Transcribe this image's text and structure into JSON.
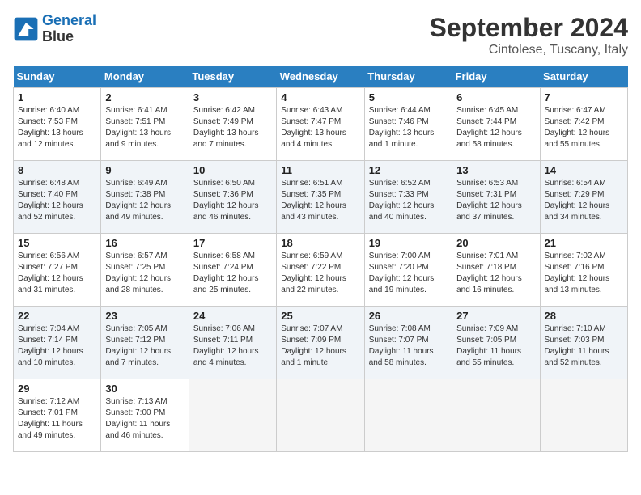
{
  "header": {
    "logo_line1": "General",
    "logo_line2": "Blue",
    "month_title": "September 2024",
    "subtitle": "Cintolese, Tuscany, Italy"
  },
  "days_of_week": [
    "Sunday",
    "Monday",
    "Tuesday",
    "Wednesday",
    "Thursday",
    "Friday",
    "Saturday"
  ],
  "weeks": [
    [
      {
        "day": "1",
        "info": "Sunrise: 6:40 AM\nSunset: 7:53 PM\nDaylight: 13 hours and 12 minutes."
      },
      {
        "day": "2",
        "info": "Sunrise: 6:41 AM\nSunset: 7:51 PM\nDaylight: 13 hours and 9 minutes."
      },
      {
        "day": "3",
        "info": "Sunrise: 6:42 AM\nSunset: 7:49 PM\nDaylight: 13 hours and 7 minutes."
      },
      {
        "day": "4",
        "info": "Sunrise: 6:43 AM\nSunset: 7:47 PM\nDaylight: 13 hours and 4 minutes."
      },
      {
        "day": "5",
        "info": "Sunrise: 6:44 AM\nSunset: 7:46 PM\nDaylight: 13 hours and 1 minute."
      },
      {
        "day": "6",
        "info": "Sunrise: 6:45 AM\nSunset: 7:44 PM\nDaylight: 12 hours and 58 minutes."
      },
      {
        "day": "7",
        "info": "Sunrise: 6:47 AM\nSunset: 7:42 PM\nDaylight: 12 hours and 55 minutes."
      }
    ],
    [
      {
        "day": "8",
        "info": "Sunrise: 6:48 AM\nSunset: 7:40 PM\nDaylight: 12 hours and 52 minutes."
      },
      {
        "day": "9",
        "info": "Sunrise: 6:49 AM\nSunset: 7:38 PM\nDaylight: 12 hours and 49 minutes."
      },
      {
        "day": "10",
        "info": "Sunrise: 6:50 AM\nSunset: 7:36 PM\nDaylight: 12 hours and 46 minutes."
      },
      {
        "day": "11",
        "info": "Sunrise: 6:51 AM\nSunset: 7:35 PM\nDaylight: 12 hours and 43 minutes."
      },
      {
        "day": "12",
        "info": "Sunrise: 6:52 AM\nSunset: 7:33 PM\nDaylight: 12 hours and 40 minutes."
      },
      {
        "day": "13",
        "info": "Sunrise: 6:53 AM\nSunset: 7:31 PM\nDaylight: 12 hours and 37 minutes."
      },
      {
        "day": "14",
        "info": "Sunrise: 6:54 AM\nSunset: 7:29 PM\nDaylight: 12 hours and 34 minutes."
      }
    ],
    [
      {
        "day": "15",
        "info": "Sunrise: 6:56 AM\nSunset: 7:27 PM\nDaylight: 12 hours and 31 minutes."
      },
      {
        "day": "16",
        "info": "Sunrise: 6:57 AM\nSunset: 7:25 PM\nDaylight: 12 hours and 28 minutes."
      },
      {
        "day": "17",
        "info": "Sunrise: 6:58 AM\nSunset: 7:24 PM\nDaylight: 12 hours and 25 minutes."
      },
      {
        "day": "18",
        "info": "Sunrise: 6:59 AM\nSunset: 7:22 PM\nDaylight: 12 hours and 22 minutes."
      },
      {
        "day": "19",
        "info": "Sunrise: 7:00 AM\nSunset: 7:20 PM\nDaylight: 12 hours and 19 minutes."
      },
      {
        "day": "20",
        "info": "Sunrise: 7:01 AM\nSunset: 7:18 PM\nDaylight: 12 hours and 16 minutes."
      },
      {
        "day": "21",
        "info": "Sunrise: 7:02 AM\nSunset: 7:16 PM\nDaylight: 12 hours and 13 minutes."
      }
    ],
    [
      {
        "day": "22",
        "info": "Sunrise: 7:04 AM\nSunset: 7:14 PM\nDaylight: 12 hours and 10 minutes."
      },
      {
        "day": "23",
        "info": "Sunrise: 7:05 AM\nSunset: 7:12 PM\nDaylight: 12 hours and 7 minutes."
      },
      {
        "day": "24",
        "info": "Sunrise: 7:06 AM\nSunset: 7:11 PM\nDaylight: 12 hours and 4 minutes."
      },
      {
        "day": "25",
        "info": "Sunrise: 7:07 AM\nSunset: 7:09 PM\nDaylight: 12 hours and 1 minute."
      },
      {
        "day": "26",
        "info": "Sunrise: 7:08 AM\nSunset: 7:07 PM\nDaylight: 11 hours and 58 minutes."
      },
      {
        "day": "27",
        "info": "Sunrise: 7:09 AM\nSunset: 7:05 PM\nDaylight: 11 hours and 55 minutes."
      },
      {
        "day": "28",
        "info": "Sunrise: 7:10 AM\nSunset: 7:03 PM\nDaylight: 11 hours and 52 minutes."
      }
    ],
    [
      {
        "day": "29",
        "info": "Sunrise: 7:12 AM\nSunset: 7:01 PM\nDaylight: 11 hours and 49 minutes."
      },
      {
        "day": "30",
        "info": "Sunrise: 7:13 AM\nSunset: 7:00 PM\nDaylight: 11 hours and 46 minutes."
      },
      null,
      null,
      null,
      null,
      null
    ]
  ]
}
